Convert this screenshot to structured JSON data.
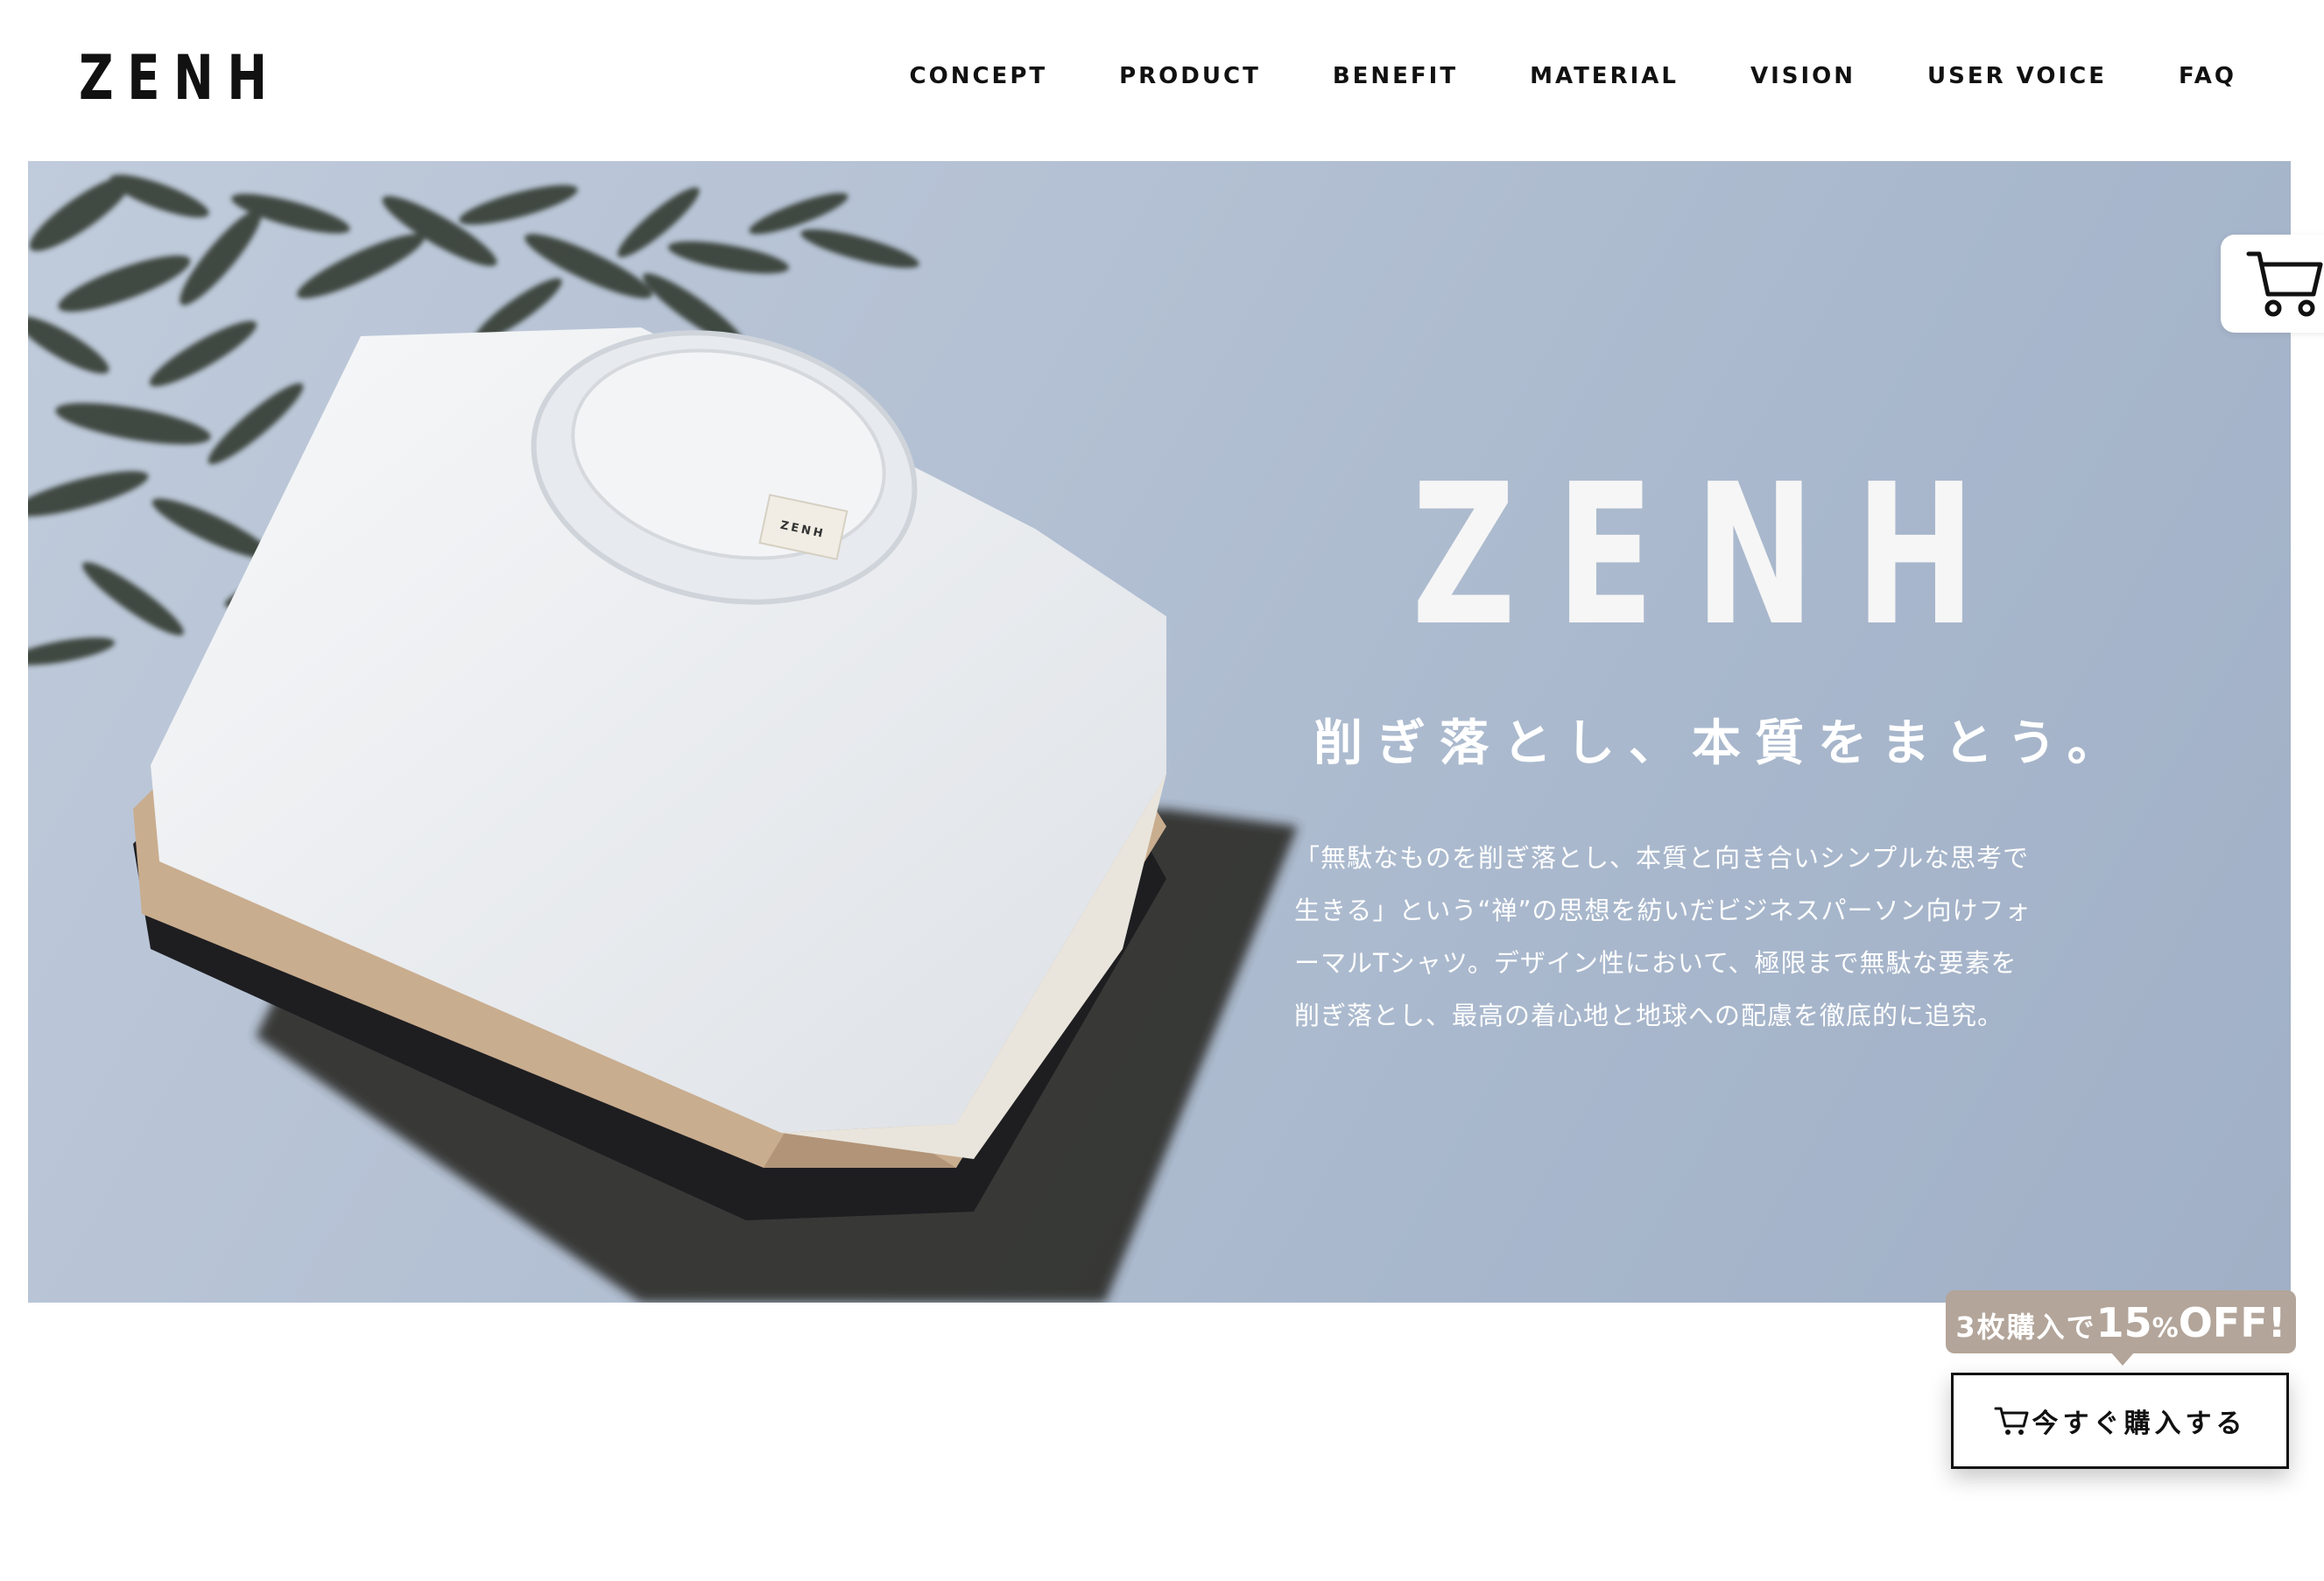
{
  "header": {
    "logo": "ZENH",
    "nav": [
      "CONCEPT",
      "PRODUCT",
      "BENEFIT",
      "MATERIAL",
      "VISION",
      "USER VOICE",
      "FAQ"
    ]
  },
  "hero": {
    "logo": "ZENH",
    "catchphrase": "削ぎ落とし、本質をまとう。",
    "description_lines": [
      "「無駄なものを削ぎ落とし、本質と向き合いシンプルな思考で",
      "生きる」という“禅”の思想を紡いだビジネスパーソン向けフォ",
      "ーマルTシャツ。デザイン性において、極限まで無駄な要素を",
      "削ぎ落とし、最高の着心地と地球への配慮を徹底的に追究。"
    ],
    "product_tag": "ZENH"
  },
  "floating_cart": {
    "icon": "cart-icon"
  },
  "promo": {
    "prefix": "3枚購入で",
    "number": "15",
    "percent": "%",
    "suffix": "OFF!"
  },
  "buy_button": {
    "icon": "cart-icon",
    "label": "今すぐ購入する"
  },
  "colors": {
    "hero_bg": "#b3c0d3",
    "promo_bg": "#b3a59a",
    "text_dark": "#111111"
  }
}
